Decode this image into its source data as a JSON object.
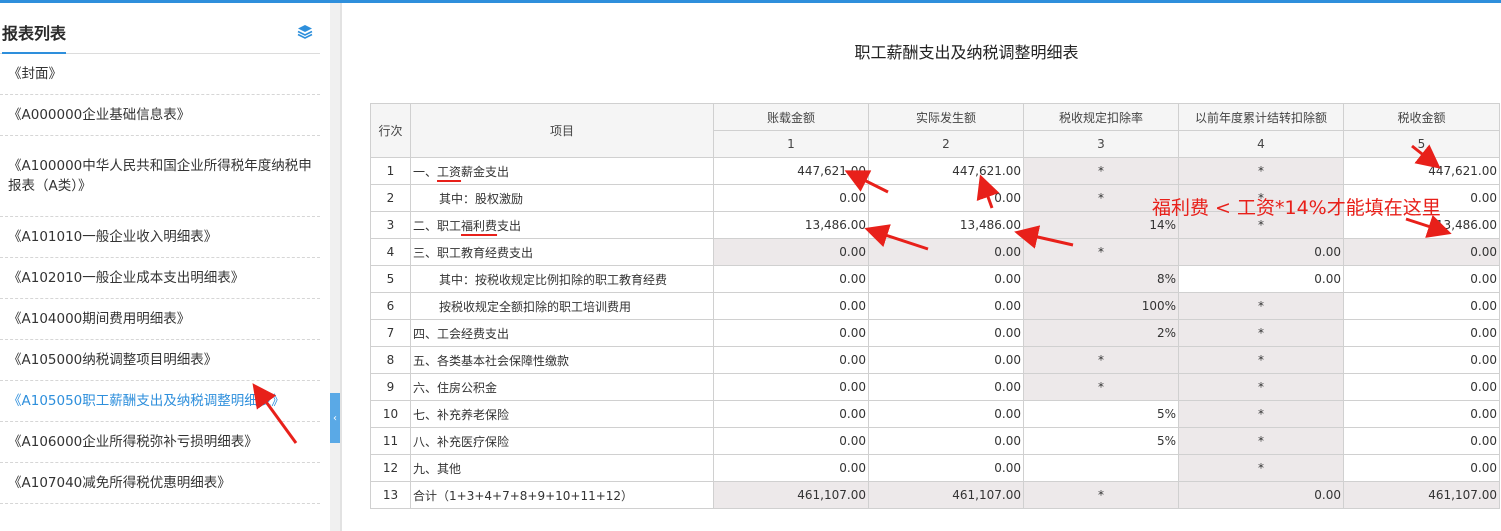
{
  "sidebar": {
    "title": "报表列表",
    "layers_icon": "layers-icon",
    "items": [
      {
        "label": "《封面》"
      },
      {
        "label": "《A000000企业基础信息表》"
      },
      {
        "label": "《A100000中华人民共和国企业所得税年度纳税申报表（A类）》"
      },
      {
        "label": "《A101010一般企业收入明细表》"
      },
      {
        "label": "《A102010一般企业成本支出明细表》"
      },
      {
        "label": "《A104000期间费用明细表》"
      },
      {
        "label": "《A105000纳税调整项目明细表》"
      },
      {
        "label": "《A105050职工薪酬支出及纳税调整明细表》",
        "active": true
      },
      {
        "label": "《A106000企业所得税弥补亏损明细表》"
      },
      {
        "label": "《A107040减免所得税优惠明细表》"
      }
    ],
    "collapse_glyph": "‹"
  },
  "main": {
    "title": "职工薪酬支出及纳税调整明细表",
    "headers": {
      "row_no": "行次",
      "item": "项目",
      "cols": [
        "账载金额",
        "实际发生额",
        "税收规定扣除率",
        "以前年度累计结转扣除额",
        "税收金额"
      ],
      "col_nums": [
        "1",
        "2",
        "3",
        "4",
        "5"
      ]
    },
    "rows": [
      {
        "no": "1",
        "pre": "一、",
        "hl": "工资",
        "post": "薪金支出",
        "c1": "447,621.00",
        "c2": "447,621.00",
        "c3": "*",
        "c4": "*",
        "c5": "447,621.00"
      },
      {
        "no": "2",
        "pre": "其中：股权激励",
        "hl": "",
        "post": "",
        "indent": true,
        "c1": "0.00",
        "c2": "0.00",
        "c3": "*",
        "c4": "*",
        "c5": "0.00"
      },
      {
        "no": "3",
        "pre": "二、职工",
        "hl": "福利费",
        "post": "支出",
        "c1": "13,486.00",
        "c2": "13,486.00",
        "c3": "14%",
        "c4": "*",
        "c5": "13,486.00"
      },
      {
        "no": "4",
        "pre": "三、职工教育经费支出",
        "hl": "",
        "post": "",
        "c1": "0.00",
        "c2": "0.00",
        "c3": "*",
        "c4": "0.00",
        "c5": "0.00"
      },
      {
        "no": "5",
        "pre": "其中：按税收规定比例扣除的职工教育经费",
        "hl": "",
        "post": "",
        "indent": true,
        "c1": "0.00",
        "c2": "0.00",
        "c3": "8%",
        "c4": "0.00",
        "c5": "0.00"
      },
      {
        "no": "6",
        "pre": "按税收规定全额扣除的职工培训费用",
        "hl": "",
        "post": "",
        "indent": true,
        "c1": "0.00",
        "c2": "0.00",
        "c3": "100%",
        "c4": "*",
        "c5": "0.00"
      },
      {
        "no": "7",
        "pre": "四、工会经费支出",
        "hl": "",
        "post": "",
        "c1": "0.00",
        "c2": "0.00",
        "c3": "2%",
        "c4": "*",
        "c5": "0.00"
      },
      {
        "no": "8",
        "pre": "五、各类基本社会保障性缴款",
        "hl": "",
        "post": "",
        "c1": "0.00",
        "c2": "0.00",
        "c3": "*",
        "c4": "*",
        "c5": "0.00"
      },
      {
        "no": "9",
        "pre": "六、住房公积金",
        "hl": "",
        "post": "",
        "c1": "0.00",
        "c2": "0.00",
        "c3": "*",
        "c4": "*",
        "c5": "0.00"
      },
      {
        "no": "10",
        "pre": "七、补充养老保险",
        "hl": "",
        "post": "",
        "c1": "0.00",
        "c2": "0.00",
        "c3": "5%",
        "c4": "*",
        "c5": "0.00"
      },
      {
        "no": "11",
        "pre": "八、补充医疗保险",
        "hl": "",
        "post": "",
        "c1": "0.00",
        "c2": "0.00",
        "c3": "5%",
        "c4": "*",
        "c5": "0.00"
      },
      {
        "no": "12",
        "pre": "九、其他",
        "hl": "",
        "post": "",
        "c1": "0.00",
        "c2": "0.00",
        "c3": "",
        "c4": "*",
        "c5": "0.00"
      },
      {
        "no": "13",
        "pre": "合计（1+3+4+7+8+9+10+11+12）",
        "hl": "",
        "post": "",
        "c1": "461,107.00",
        "c2": "461,107.00",
        "c3": "*",
        "c4": "0.00",
        "c5": "461,107.00"
      }
    ]
  },
  "annotation": {
    "text": "福利费 < 工资*14%才能填在这里",
    "color": "#e8201a"
  },
  "colors": {
    "accent": "#2e8fdc",
    "readonly_cell": "#ede9ea",
    "annotation_red": "#e8201a"
  }
}
